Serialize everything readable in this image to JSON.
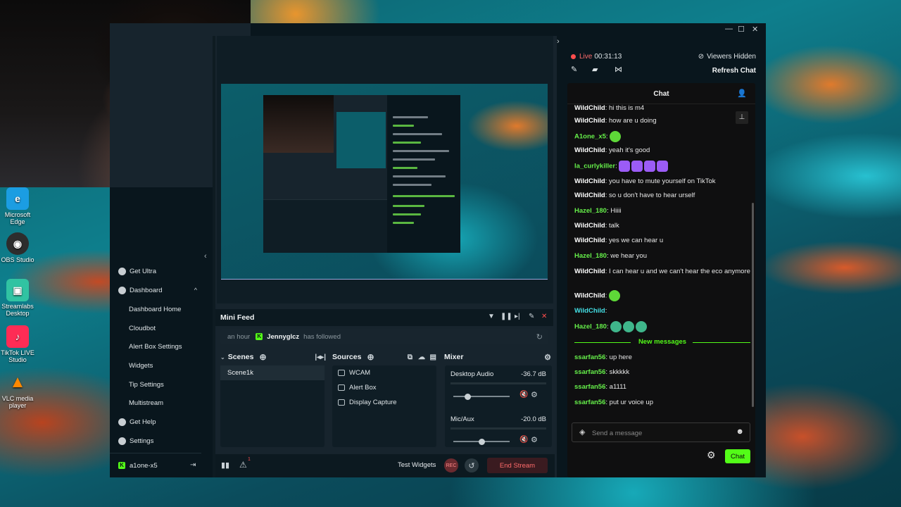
{
  "desktop": {
    "icons": [
      {
        "label": "Microsoft Edge",
        "color": "#1b9de2",
        "icon": "edge-icon"
      },
      {
        "label": "OBS Studio",
        "color": "#2d2d2d",
        "icon": "obs-icon"
      },
      {
        "label": "Streamlabs Desktop",
        "color": "#31c3a2",
        "icon": "streamlabs-icon"
      },
      {
        "label": "TikTok LIVE Studio",
        "color": "#fe2c55",
        "icon": "tiktok-icon"
      },
      {
        "label": "VLC media player",
        "color": "#ff8800",
        "icon": "vlc-icon"
      }
    ]
  },
  "sidebar": {
    "items": [
      {
        "label": "Get Ultra",
        "icon": "ultra-icon"
      },
      {
        "label": "Dashboard",
        "icon": "dashboard-icon"
      },
      {
        "label": "Dashboard Home"
      },
      {
        "label": "Cloudbot"
      },
      {
        "label": "Alert Box Settings"
      },
      {
        "label": "Widgets"
      },
      {
        "label": "Tip Settings"
      },
      {
        "label": "Multistream"
      },
      {
        "label": "Get Help",
        "icon": "help-icon"
      },
      {
        "label": "Settings",
        "icon": "settings-icon"
      }
    ],
    "user": "a1one-x5"
  },
  "minifeed": {
    "title": "Mini Feed",
    "time": "an hour",
    "user": "Jennyglcz",
    "action": "has followed"
  },
  "scenes": {
    "title": "Scenes",
    "items": [
      "Scene1k"
    ]
  },
  "sources": {
    "title": "Sources",
    "items": [
      "WCAM",
      "Alert Box",
      "Display Capture"
    ]
  },
  "mixer": {
    "title": "Mixer",
    "channels": [
      {
        "name": "Desktop Audio",
        "db": "-36.7 dB",
        "level": 0.25
      },
      {
        "name": "Mic/Aux",
        "db": "-20.0 dB",
        "level": 0.5
      }
    ]
  },
  "footer": {
    "test_widgets": "Test Widgets",
    "rec": "REC",
    "end_stream": "End Stream",
    "alerts_count": "1"
  },
  "stream": {
    "live_label": "Live",
    "time": "00:31:13",
    "viewers": "Viewers Hidden",
    "refresh": "Refresh Chat"
  },
  "chat": {
    "title": "Chat",
    "messages": [
      {
        "user": "WildChild",
        "text": "hi this is m4",
        "color": "white"
      },
      {
        "user": "WildChild",
        "text": "how are u doing",
        "color": "white"
      },
      {
        "user": "A1one_x5",
        "text": "",
        "color": "green",
        "emotes": [
          "green"
        ]
      },
      {
        "user": "WildChild",
        "text": "yeah it's good",
        "color": "white"
      },
      {
        "user": "la_curlykiller",
        "text": "",
        "color": "green",
        "emotes": [
          "purple",
          "purple",
          "purple",
          "purple"
        ]
      },
      {
        "user": "WildChild",
        "text": "you have to mute yourself on TikTok",
        "color": "white"
      },
      {
        "user": "WildChild",
        "text": "so u don't have to hear urself",
        "color": "white"
      },
      {
        "user": "Hazel_180",
        "text": "Hiiii",
        "color": "green"
      },
      {
        "user": "WildChild",
        "text": "talk",
        "color": "white"
      },
      {
        "user": "WildChild",
        "text": "yes we can hear u",
        "color": "white"
      },
      {
        "user": "Hazel_180",
        "text": "we hear you",
        "color": "green"
      },
      {
        "user": "WildChild",
        "text": "I can hear u and we can't hear the eco anymore",
        "color": "white"
      },
      {
        "user": "WildChild",
        "text": "",
        "color": "white",
        "emotes": [
          "green"
        ]
      },
      {
        "user": "WildChild",
        "text": "",
        "color": "cyan"
      },
      {
        "user": "Hazel_180",
        "text": "",
        "color": "green",
        "emotes": [
          "frog",
          "frog",
          "frog"
        ]
      }
    ],
    "new_messages_label": "New messages",
    "new_messages": [
      {
        "user": "ssarfan56",
        "text": "up here"
      },
      {
        "user": "ssarfan56",
        "text": "skkkkk"
      },
      {
        "user": "ssarfan56",
        "text": "a1111"
      },
      {
        "user": "ssarfan56",
        "text": "put ur voice up"
      }
    ],
    "placeholder": "Send a message",
    "send_label": "Chat"
  }
}
